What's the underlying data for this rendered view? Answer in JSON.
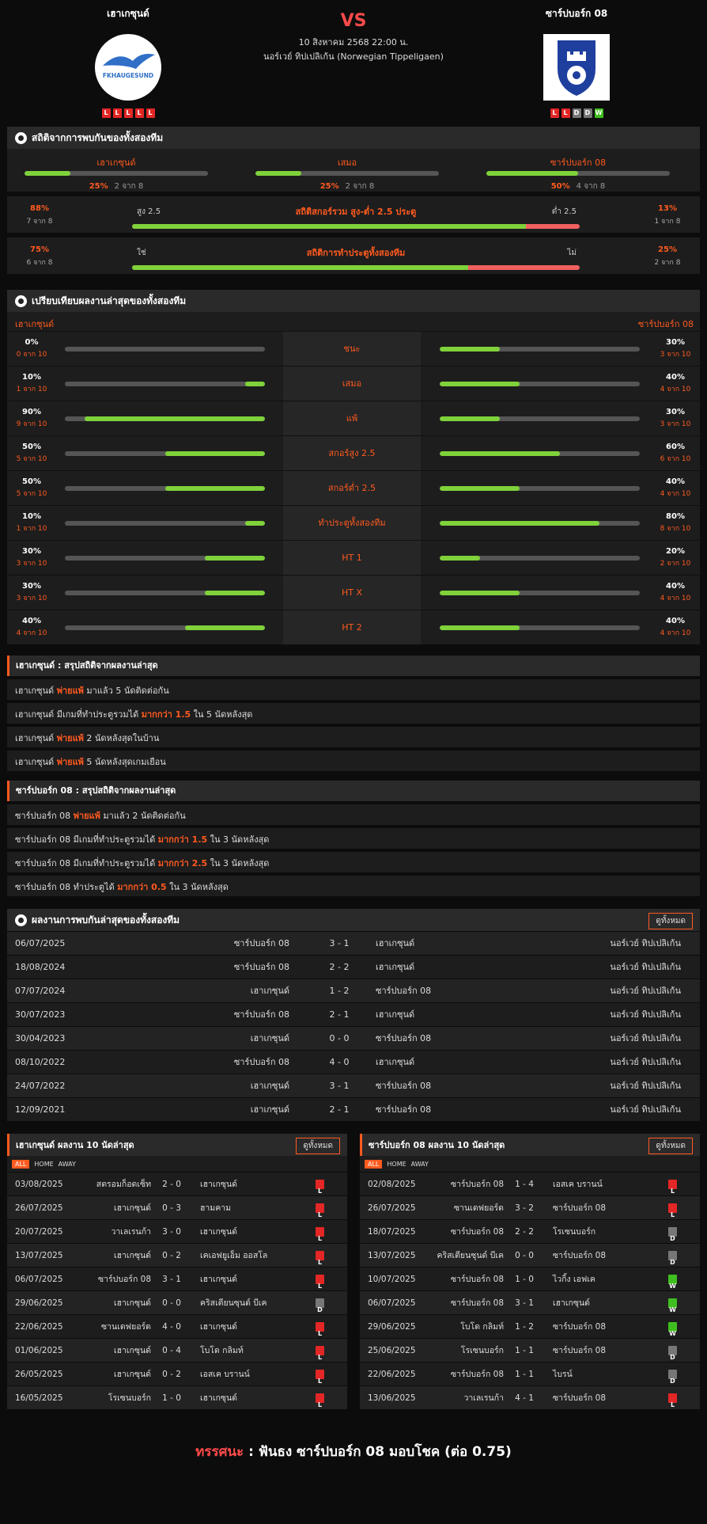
{
  "home": {
    "name": "เฮาเกซุนด์",
    "logo_text": "FKHAUGESUND",
    "form": [
      "L",
      "L",
      "L",
      "L",
      "L"
    ]
  },
  "away": {
    "name": "ซาร์ปบอร์ก 08",
    "form": [
      "L",
      "L",
      "D",
      "D",
      "W"
    ]
  },
  "match": {
    "vs": "VS",
    "date": "10 สิงหาคม 2568 22:00 น.",
    "competition": "นอร์เวย์ ทิปเปลิเก้น (Norwegian Tippeligaen)"
  },
  "h2h_stats": {
    "title": "สถิติจากการพบกันของทั้งสองทีม",
    "cols": [
      {
        "label": "เฮาเกซุนด์",
        "pct": "25%",
        "sub": "2 จาก 8",
        "fill": 25
      },
      {
        "label": "เสมอ",
        "pct": "25%",
        "sub": "2 จาก 8",
        "fill": 25
      },
      {
        "label": "ซาร์ปบอร์ก 08",
        "pct": "50%",
        "sub": "4 จาก 8",
        "fill": 50
      }
    ],
    "ou": {
      "title": "สถิติสกอร์รวม สูง-ต่ำ 2.5 ประตู",
      "left_label": "สูง 2.5",
      "right_label": "ต่ำ 2.5",
      "left_pct": "88%",
      "left_sub": "7 จาก 8",
      "right_pct": "13%",
      "right_sub": "1 จาก 8",
      "fill": 88
    },
    "btts": {
      "title": "สถิติการทำประตูทั้งสองทีม",
      "left_label": "ใช่",
      "right_label": "ไม่",
      "left_pct": "75%",
      "left_sub": "6 จาก 8",
      "right_pct": "25%",
      "right_sub": "2 จาก 8",
      "fill": 75
    }
  },
  "compare": {
    "title": "เปรียบเทียบผลงานล่าสุดของทั้งสองทีม",
    "home_name": "เฮาเกซุนด์",
    "away_name": "ซาร์ปบอร์ก 08",
    "rows": [
      {
        "label": "ชนะ",
        "hv": "0%",
        "hs": "0 จาก 10",
        "hf": 0,
        "av": "30%",
        "as": "3 จาก 10",
        "af": 30
      },
      {
        "label": "เสมอ",
        "hv": "10%",
        "hs": "1 จาก 10",
        "hf": 10,
        "av": "40%",
        "as": "4 จาก 10",
        "af": 40
      },
      {
        "label": "แพ้",
        "hv": "90%",
        "hs": "9 จาก 10",
        "hf": 90,
        "av": "30%",
        "as": "3 จาก 10",
        "af": 30
      },
      {
        "label": "สกอร์สูง 2.5",
        "hv": "50%",
        "hs": "5 จาก 10",
        "hf": 50,
        "av": "60%",
        "as": "6 จาก 10",
        "af": 60
      },
      {
        "label": "สกอร์ต่ำ 2.5",
        "hv": "50%",
        "hs": "5 จาก 10",
        "hf": 50,
        "av": "40%",
        "as": "4 จาก 10",
        "af": 40
      },
      {
        "label": "ทำประตูทั้งสองทีม",
        "hv": "10%",
        "hs": "1 จาก 10",
        "hf": 10,
        "av": "80%",
        "as": "8 จาก 10",
        "af": 80
      },
      {
        "label": "HT 1",
        "hv": "30%",
        "hs": "3 จาก 10",
        "hf": 30,
        "av": "20%",
        "as": "2 จาก 10",
        "af": 20
      },
      {
        "label": "HT X",
        "hv": "30%",
        "hs": "3 จาก 10",
        "hf": 30,
        "av": "40%",
        "as": "4 จาก 10",
        "af": 40
      },
      {
        "label": "HT 2",
        "hv": "40%",
        "hs": "4 จาก 10",
        "hf": 40,
        "av": "40%",
        "as": "4 จาก 10",
        "af": 40
      }
    ]
  },
  "home_summary": {
    "title": "เฮาเกซุนด์ : สรุปสถิติจากผลงานล่าสุด",
    "rows": [
      [
        {
          "t": "เฮาเกซุนด์ "
        },
        {
          "t": "พ่ายแพ้",
          "h": 1
        },
        {
          "t": " มาแล้ว 5 นัดติดต่อกัน"
        }
      ],
      [
        {
          "t": "เฮาเกซุนด์ มีเกมที่ทำประตูรวมได้ "
        },
        {
          "t": "มากกว่า 1.5",
          "h": 1
        },
        {
          "t": " ใน 5 นัดหลังสุด"
        }
      ],
      [
        {
          "t": "เฮาเกซุนด์ "
        },
        {
          "t": "พ่ายแพ้",
          "h": 1
        },
        {
          "t": " 2 นัดหลังสุดในบ้าน"
        }
      ],
      [
        {
          "t": "เฮาเกซุนด์ "
        },
        {
          "t": "พ่ายแพ้",
          "h": 1
        },
        {
          "t": " 5 นัดหลังสุดเกมเยือน"
        }
      ]
    ]
  },
  "away_summary": {
    "title": "ซาร์ปบอร์ก 08 : สรุปสถิติจากผลงานล่าสุด",
    "rows": [
      [
        {
          "t": "ซาร์ปบอร์ก 08 "
        },
        {
          "t": "พ่ายแพ้",
          "h": 1
        },
        {
          "t": " มาแล้ว 2 นัดติดต่อกัน"
        }
      ],
      [
        {
          "t": "ซาร์ปบอร์ก 08 มีเกมที่ทำประตูรวมได้ "
        },
        {
          "t": "มากกว่า 1.5",
          "h": 1
        },
        {
          "t": " ใน 3 นัดหลังสุด"
        }
      ],
      [
        {
          "t": "ซาร์ปบอร์ก 08 มีเกมที่ทำประตูรวมได้ "
        },
        {
          "t": "มากกว่า 2.5",
          "h": 1
        },
        {
          "t": " ใน 3 นัดหลังสุด"
        }
      ],
      [
        {
          "t": "ซาร์ปบอร์ก 08 ทำประตูได้ "
        },
        {
          "t": "มากกว่า 0.5",
          "h": 1
        },
        {
          "t": " ใน 3 นัดหลังสุด"
        }
      ]
    ]
  },
  "h2h_results": {
    "title": "ผลงานการพบกันล่าสุดของทั้งสองทีม",
    "all_label": "ดูทั้งหมด",
    "rows": [
      [
        "06/07/2025",
        "ซาร์ปบอร์ก 08",
        "3 - 1",
        "เฮาเกซุนด์",
        "นอร์เวย์ ทิปเปลิเก้น"
      ],
      [
        "18/08/2024",
        "ซาร์ปบอร์ก 08",
        "2 - 2",
        "เฮาเกซุนด์",
        "นอร์เวย์ ทิปเปลิเก้น"
      ],
      [
        "07/07/2024",
        "เฮาเกซุนด์",
        "1 - 2",
        "ซาร์ปบอร์ก 08",
        "นอร์เวย์ ทิปเปลิเก้น"
      ],
      [
        "30/07/2023",
        "ซาร์ปบอร์ก 08",
        "2 - 1",
        "เฮาเกซุนด์",
        "นอร์เวย์ ทิปเปลิเก้น"
      ],
      [
        "30/04/2023",
        "เฮาเกซุนด์",
        "0 - 0",
        "ซาร์ปบอร์ก 08",
        "นอร์เวย์ ทิปเปลิเก้น"
      ],
      [
        "08/10/2022",
        "ซาร์ปบอร์ก 08",
        "4 - 0",
        "เฮาเกซุนด์",
        "นอร์เวย์ ทิปเปลิเก้น"
      ],
      [
        "24/07/2022",
        "เฮาเกซุนด์",
        "3 - 1",
        "ซาร์ปบอร์ก 08",
        "นอร์เวย์ ทิปเปลิเก้น"
      ],
      [
        "12/09/2021",
        "เฮาเกซุนด์",
        "2 - 1",
        "ซาร์ปบอร์ก 08",
        "นอร์เวย์ ทิปเปลิเก้น"
      ]
    ]
  },
  "last10": {
    "filters": [
      "ALL",
      "HOME",
      "AWAY"
    ],
    "all_label": "ดูทั้งหมด",
    "home": {
      "title": "เฮาเกซุนด์ ผลงาน 10 นัดล่าสุด",
      "rows": [
        [
          "03/08/2025",
          "สตรอมก็อดเซ็ท",
          "2 - 0",
          "เฮาเกซุนด์",
          "L"
        ],
        [
          "26/07/2025",
          "เฮาเกซุนด์",
          "0 - 3",
          "ฮามคาม",
          "L"
        ],
        [
          "20/07/2025",
          "วาเลเรนก้า",
          "3 - 0",
          "เฮาเกซุนด์",
          "L"
        ],
        [
          "13/07/2025",
          "เฮาเกซุนด์",
          "0 - 2",
          "เคเอฟยูเอ็ม ออสโล",
          "L"
        ],
        [
          "06/07/2025",
          "ซาร์ปบอร์ก 08",
          "3 - 1",
          "เฮาเกซุนด์",
          "L"
        ],
        [
          "29/06/2025",
          "เฮาเกซุนด์",
          "0 - 0",
          "คริสเตียนซุนด์ บีเค",
          "D"
        ],
        [
          "22/06/2025",
          "ซานเดฟยอร์ด",
          "4 - 0",
          "เฮาเกซุนด์",
          "L"
        ],
        [
          "01/06/2025",
          "เฮาเกซุนด์",
          "0 - 4",
          "โบโด กลิมท์",
          "L"
        ],
        [
          "26/05/2025",
          "เฮาเกซุนด์",
          "0 - 2",
          "เอสเค บรานน์",
          "L"
        ],
        [
          "16/05/2025",
          "โรเซนบอร์ก",
          "1 - 0",
          "เฮาเกซุนด์",
          "L"
        ]
      ]
    },
    "away": {
      "title": "ซาร์ปบอร์ก 08 ผลงาน 10 นัดล่าสุด",
      "rows": [
        [
          "02/08/2025",
          "ซาร์ปบอร์ก 08",
          "1 - 4",
          "เอสเค บรานน์",
          "L"
        ],
        [
          "26/07/2025",
          "ซานเดฟยอร์ด",
          "3 - 2",
          "ซาร์ปบอร์ก 08",
          "L"
        ],
        [
          "18/07/2025",
          "ซาร์ปบอร์ก 08",
          "2 - 2",
          "โรเซนบอร์ก",
          "D"
        ],
        [
          "13/07/2025",
          "คริสเตียนซุนด์ บีเค",
          "0 - 0",
          "ซาร์ปบอร์ก 08",
          "D"
        ],
        [
          "10/07/2025",
          "ซาร์ปบอร์ก 08",
          "1 - 0",
          "ไวกิ้ง เอฟเค",
          "W"
        ],
        [
          "06/07/2025",
          "ซาร์ปบอร์ก 08",
          "3 - 1",
          "เฮาเกซุนด์",
          "W"
        ],
        [
          "29/06/2025",
          "โบโด กลิมท์",
          "1 - 2",
          "ซาร์ปบอร์ก 08",
          "W"
        ],
        [
          "25/06/2025",
          "โรเซนบอร์ก",
          "1 - 1",
          "ซาร์ปบอร์ก 08",
          "D"
        ],
        [
          "22/06/2025",
          "ซาร์ปบอร์ก 08",
          "1 - 1",
          "ไบรน์",
          "D"
        ],
        [
          "13/06/2025",
          "วาเลเรนก้า",
          "4 - 1",
          "ซาร์ปบอร์ก 08",
          "L"
        ]
      ]
    }
  },
  "verdict": {
    "label": "ทรรศนะ",
    "text": " :  ฟันธง ซาร์ปบอร์ก 08 มอบโชค (ต่อ 0.75)"
  },
  "colors": {
    "accent": "#ff5a1f",
    "win": "#3fbf1f",
    "loss": "#e32626",
    "draw": "#777777",
    "bar_fill": "#7fd23a"
  }
}
